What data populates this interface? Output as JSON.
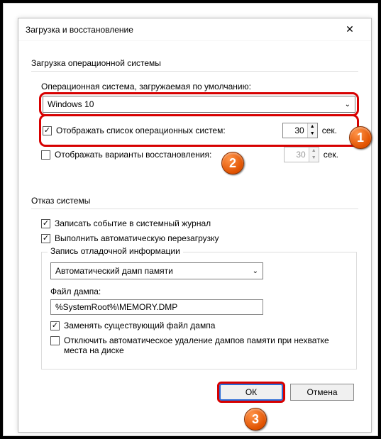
{
  "title": "Загрузка и восстановление",
  "startup": {
    "section_label": "Загрузка операционной системы",
    "field_default_os": "Операционная система, загружаемая по умолчанию:",
    "default_os_selected": "Windows 10",
    "cb_show_os_list": "Отображать список операционных систем:",
    "os_list_secs": "30",
    "cb_show_recovery": "Отображать варианты восстановления:",
    "recovery_secs": "30",
    "sec_label": "сек."
  },
  "failure": {
    "section_label": "Отказ системы",
    "cb_write_event": "Записать событие в системный журнал",
    "cb_auto_restart": "Выполнить автоматическую перезагрузку",
    "debug_info_label": "Запись отладочной информации",
    "dump_type": "Автоматический дамп памяти",
    "dump_file_label": "Файл дампа:",
    "dump_file_path": "%SystemRoot%\\MEMORY.DMP",
    "cb_replace_existing": "Заменять существующий файл дампа",
    "cb_disable_auto_delete": "Отключить автоматическое удаление дампов памяти при нехватке места на диске"
  },
  "buttons": {
    "ok": "ОК",
    "cancel": "Отмена"
  },
  "callouts": {
    "c1": "1",
    "c2": "2",
    "c3": "3"
  }
}
